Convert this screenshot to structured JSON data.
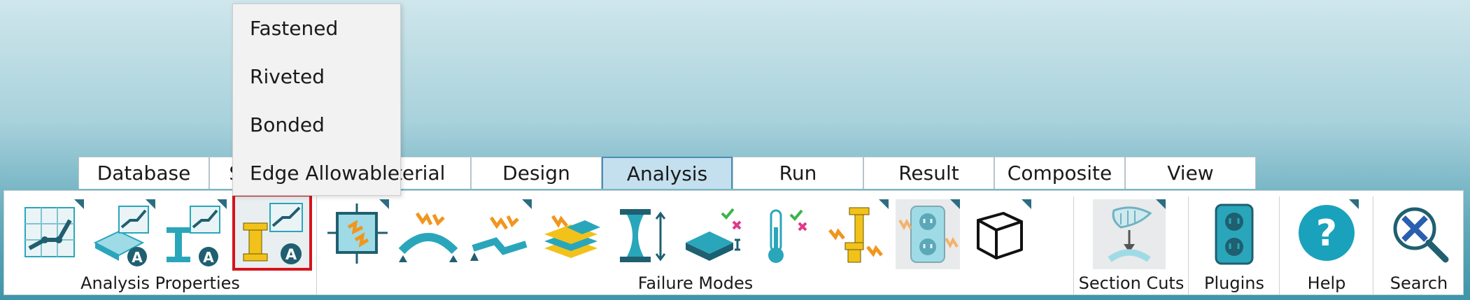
{
  "tabs": [
    "Database",
    "Structure",
    "Material",
    "Design",
    "Analysis",
    "Run",
    "Result",
    "Composite",
    "View"
  ],
  "active_tab": "Analysis",
  "dropdown": {
    "items": [
      "Fastened",
      "Riveted",
      "Bonded",
      "Edge Allowable"
    ]
  },
  "groups": {
    "analysis_properties": {
      "label": "Analysis Properties",
      "tools": [
        "analysis-graph-icon",
        "panel-analysis-icon",
        "beam-analysis-icon",
        "joint-analysis-icon"
      ]
    },
    "failure_modes": {
      "label": "Failure Modes",
      "tools": [
        "panel-buckling-icon",
        "curved-panel-icon",
        "crippling-icon",
        "laminate-icon",
        "column-icon",
        "plate-check-icon",
        "thermal-icon",
        "joint-failure-icon",
        "plug-failure-icon",
        "box-icon"
      ]
    },
    "section_cuts": {
      "label": "Section Cuts"
    },
    "plugins": {
      "label": "Plugins"
    },
    "help": {
      "label": "Help",
      "symbol": "?"
    },
    "search": {
      "label": "Search"
    }
  },
  "colors": {
    "teal": "#2aa6bb",
    "dark_teal": "#1f5f70",
    "orange": "#f0961e",
    "gold": "#f2c21b",
    "selected_outline": "#d6141c",
    "active_tab_bg": "#c4e0ef"
  }
}
